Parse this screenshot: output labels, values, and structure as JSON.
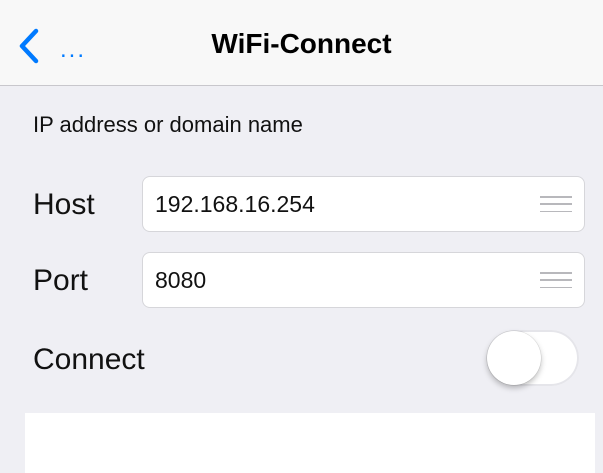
{
  "navbar": {
    "back_label": "...",
    "title": "WiFi-Connect"
  },
  "form": {
    "section_header": "IP address or domain name",
    "host": {
      "label": "Host",
      "value": "192.168.16.254"
    },
    "port": {
      "label": "Port",
      "value": "8080"
    },
    "connect": {
      "label": "Connect",
      "on": false
    }
  },
  "icons": {
    "back": "chevron-left-icon",
    "reorder": "drag-handle-icon"
  },
  "colors": {
    "accent": "#007aff",
    "background": "#efeff4",
    "navbar": "#f8f8f8"
  }
}
